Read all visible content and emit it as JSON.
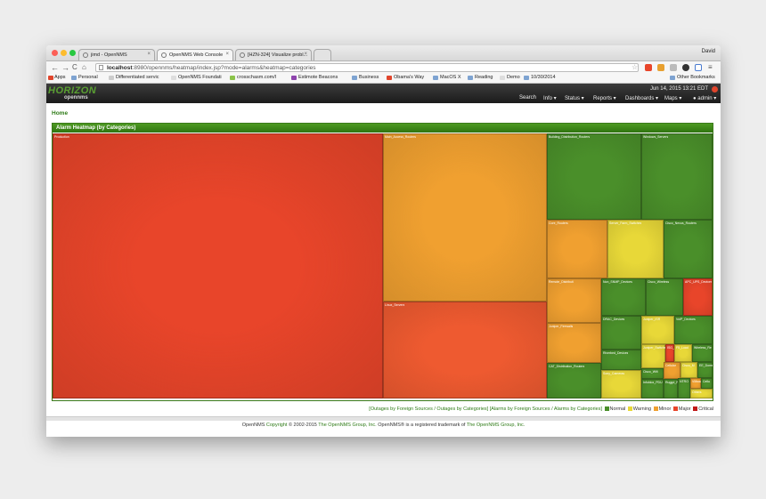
{
  "browser": {
    "user": "David",
    "tabs": [
      {
        "label": "jimd - OpenNMS",
        "active": false
      },
      {
        "label": "OpenNMS Web Console",
        "active": true
      },
      {
        "label": "[HZN-324] Visualize probl...",
        "active": false
      }
    ],
    "url_host": "localhost",
    "url_path": ":8980/opennms/heatmap/index.jsp?mode=alarms&heatmap=categories",
    "bookmarks": [
      "Apps",
      "Personal",
      "Differentiated servic",
      "OpenNMS Foundati",
      "crosschasm.com/l",
      "Estimote Beacons",
      "Business",
      "Obama's Way",
      "MacOS X",
      "Reading",
      "Demo",
      "10/30/2014"
    ],
    "other_bookmarks": "Other Bookmarks"
  },
  "header": {
    "logo_top": "HORIZON",
    "logo_bottom": "opennms",
    "datetime": "Jun 14, 2015 13:21 EDT",
    "menu": [
      "Search",
      "Info ▾",
      "Status ▾",
      "Reports ▾",
      "Dashboards ▾",
      "Maps ▾",
      "admin ▾"
    ]
  },
  "breadcrumb": "Home",
  "panel_title": "Alarm Heatmap (by Categories)",
  "heatmap": {
    "cells": [
      {
        "label": "Production",
        "color": "#e8452a"
      },
      {
        "label": "Main_Access_Routers",
        "color": "#f0a030"
      },
      {
        "label": "Linux_Servers",
        "color": "#ee5a30"
      },
      {
        "label": "Building_Distribution_Routers",
        "color": "#4a8f2a"
      },
      {
        "label": "Windows_Servers",
        "color": "#4a8f2a"
      },
      {
        "label": "Core_Routers",
        "color": "#f0a030"
      },
      {
        "label": "Server_Farm_Switches",
        "color": "#e8d838"
      },
      {
        "label": "Cisco_Nexus_Routers",
        "color": "#4a8f2a"
      },
      {
        "label": "Remote_Distributi",
        "color": "#f0a030"
      },
      {
        "label": "Non_SNMP_Devices",
        "color": "#4a8f2a"
      },
      {
        "label": "Cisco_Wireless",
        "color": "#4a8f2a"
      },
      {
        "label": "APC_UPS_Devices",
        "color": "#e8452a"
      },
      {
        "label": "Juniper_Firewalls",
        "color": "#f0a030"
      },
      {
        "label": "DRAC_Devices",
        "color": "#4a8f2a"
      },
      {
        "label": "Juniper_ISR",
        "color": "#e8d838"
      },
      {
        "label": "VoIP_Devices",
        "color": "#4a8f2a"
      },
      {
        "label": "Riverbed_Devices",
        "color": "#4a8f2a"
      },
      {
        "label": "Juniper_Switches",
        "color": "#e8d838"
      },
      {
        "label": "ISG_Swit",
        "color": "#e8452a"
      },
      {
        "label": "F5_Load",
        "color": "#e8d838"
      },
      {
        "label": "Wireless_Re",
        "color": "#4a8f2a"
      },
      {
        "label": "CAT_Distribution_Routers",
        "color": "#4a8f2a"
      },
      {
        "label": "Cisco_Wifi",
        "color": "#4a8f2a"
      },
      {
        "label": "Cellular",
        "color": "#f0a030"
      },
      {
        "label": "Cisco_M",
        "color": "#e8d838"
      },
      {
        "label": "EE_Dome",
        "color": "#4a8f2a"
      },
      {
        "label": "Sony_Cameras",
        "color": "#e8d838"
      },
      {
        "label": "Infoblox_PDU",
        "color": "#4a8f2a"
      },
      {
        "label": "Ruggd_Rou",
        "color": "#4a8f2a"
      },
      {
        "label": "NTRO",
        "color": "#4a8f2a"
      },
      {
        "label": "VMware",
        "color": "#f0a030"
      },
      {
        "label": "Cellu",
        "color": "#4a8f2a"
      },
      {
        "label": "Others",
        "color": "#e8d838"
      }
    ]
  },
  "legend": {
    "links": "[Outages by Foreign Sources / Outages by Categories]  [Alarms by Foreign Sources / Alarms by Categories]",
    "items": [
      {
        "label": "Normal",
        "color": "#4a8f2a"
      },
      {
        "label": "Warning",
        "color": "#e8d838"
      },
      {
        "label": "Minor",
        "color": "#f0a030"
      },
      {
        "label": "Major",
        "color": "#e8452a"
      },
      {
        "label": "Critical",
        "color": "#c01818"
      }
    ]
  },
  "footer": {
    "prefix": "OpenNMS ",
    "copyright_link": "Copyright",
    "mid": " © 2002-2015 ",
    "group_link": "The OpenNMS Group, Inc.",
    "mid2": " OpenNMS® is a registered trademark of ",
    "group_link2": "The OpenNMS Group, Inc."
  }
}
